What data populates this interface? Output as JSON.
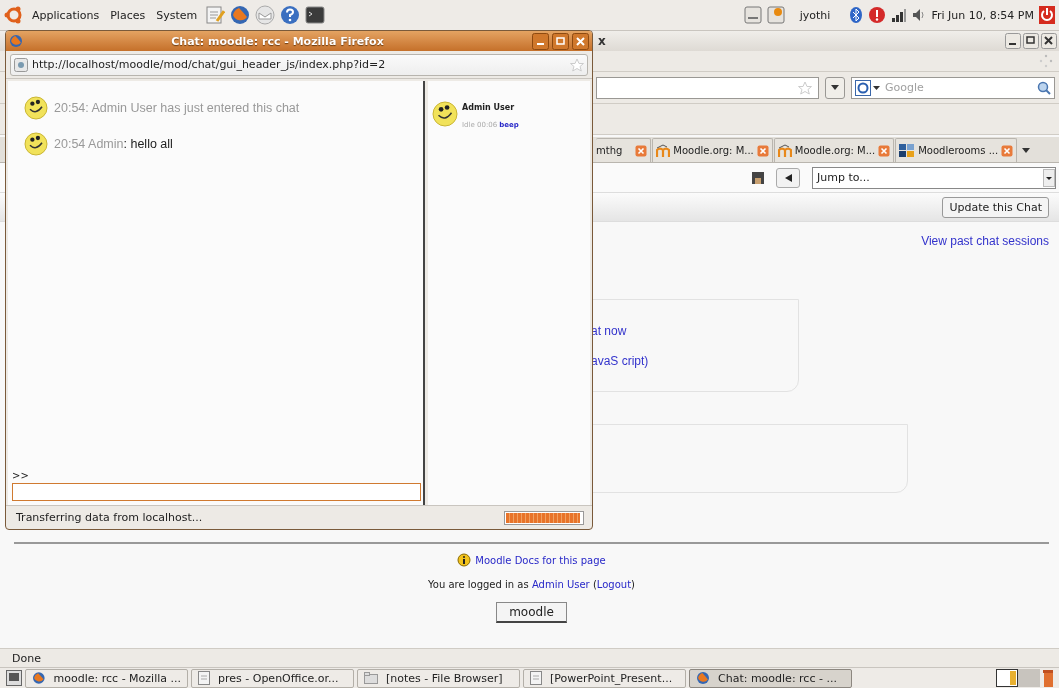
{
  "top_panel": {
    "menus": [
      "Applications",
      "Places",
      "System"
    ],
    "user": "jyothi",
    "clock": "Fri Jun 10,  8:54 PM"
  },
  "browser": {
    "title_fragment": "x",
    "search": {
      "placeholder": "Google"
    },
    "tabs": [
      {
        "label": "mthg",
        "selected": false,
        "kind": "plain"
      },
      {
        "label": "Moodle.org: M...",
        "selected": false,
        "kind": "moodle"
      },
      {
        "label": "Moodle.org: M...",
        "selected": false,
        "kind": "moodle"
      },
      {
        "label": "Moodlerooms ...",
        "selected": false,
        "kind": "rooms"
      }
    ],
    "jump": {
      "value": "Jump to..."
    },
    "update_button": "Update this Chat",
    "past_sessions_link": "View past chat sessions",
    "chat_links": [
      "at now",
      "avaS cript)"
    ],
    "docs_link": "Moodle Docs for this page",
    "login": {
      "before": "You are logged in as ",
      "user": "Admin User",
      "between": " (",
      "logout": "Logout",
      "after": ")"
    },
    "home_button": "moodle",
    "status": "Done"
  },
  "chat_window": {
    "title": "Chat: moodle: rcc - Mozilla Firefox",
    "url": "http://localhost/moodle/mod/chat/gui_header_js/index.php?id=2",
    "messages": [
      {
        "kind": "system",
        "text": "20:54: Admin User has just entered this chat"
      },
      {
        "kind": "message",
        "time": "20:54",
        "sender": "Admin",
        "text": ": hello all"
      }
    ],
    "users": [
      {
        "name": "Admin User",
        "idle": "Idle 00:06",
        "action": "beep"
      }
    ],
    "prompt": ">>",
    "status": "Transferring data from localhost...",
    "progress": {
      "level": 0.97
    }
  },
  "taskbar": {
    "tasks": [
      {
        "label": "moodle: rcc - Mozilla ...",
        "kind": "firefox",
        "selected": false
      },
      {
        "label": "pres - OpenOffice.or...",
        "kind": "document",
        "selected": false
      },
      {
        "label": "[notes - File Browser]",
        "kind": "folder",
        "selected": false
      },
      {
        "label": "[PowerPoint_Present...",
        "kind": "document",
        "selected": false
      },
      {
        "label": "Chat: moodle: rcc - ...",
        "kind": "firefox",
        "selected": true
      }
    ]
  }
}
